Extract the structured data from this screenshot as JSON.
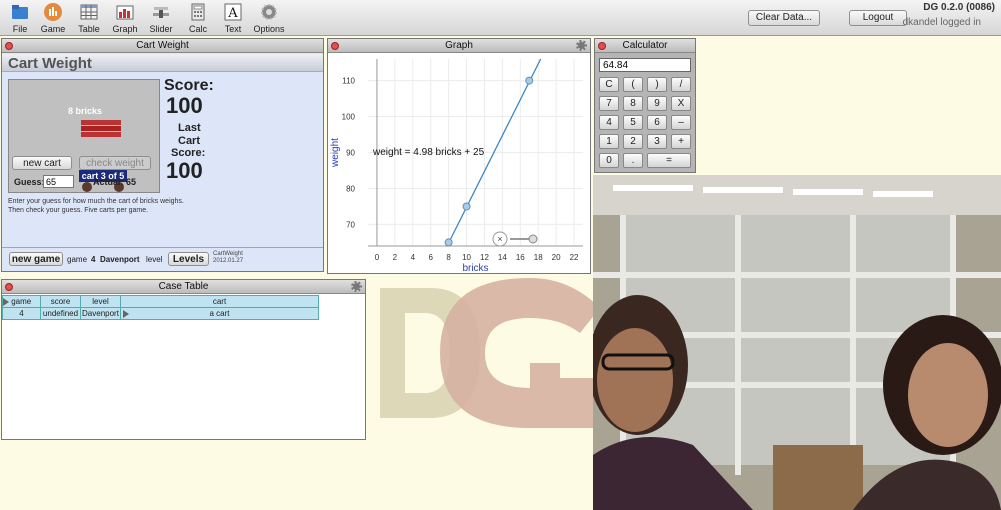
{
  "toolbar": {
    "items": [
      {
        "label": "File",
        "icon": "folder-icon"
      },
      {
        "label": "Game",
        "icon": "game-icon"
      },
      {
        "label": "Table",
        "icon": "table-icon"
      },
      {
        "label": "Graph",
        "icon": "graph-icon"
      },
      {
        "label": "Slider",
        "icon": "slider-icon"
      },
      {
        "label": "Calc",
        "icon": "calculator-icon"
      },
      {
        "label": "Text",
        "icon": "text-icon"
      },
      {
        "label": "Options",
        "icon": "gear-icon"
      }
    ],
    "clear_data": "Clear Data...",
    "logout": "Logout",
    "version": "DG 0.2.0 (0086)",
    "user": "dkandel logged in"
  },
  "cart_panel": {
    "title": "Cart Weight",
    "heading": "Cart Weight",
    "bricks_label": "8 bricks",
    "cart_label": "cart 3 of 5",
    "new_cart": "new cart",
    "check_weight": "check weight",
    "guess_label": "Guess:",
    "guess_value": "65",
    "actual_label": "Actual:",
    "actual_value": "65",
    "score_label": "Score:",
    "score_value": "100",
    "last_label_1": "Last",
    "last_label_2": "Cart",
    "last_label_3": "Score:",
    "last_value": "100",
    "instructions_1": "Enter your guess for how much the cart of bricks weighs.",
    "instructions_2": "Then check your guess. Five carts per game.",
    "new_game": "new game",
    "game_label": "game",
    "game_number": "4",
    "level_name": "Davenport",
    "level_label": "level",
    "levels_button": "Levels",
    "app_name": "CartWeight",
    "app_date": "2012.01.27"
  },
  "graph_panel": {
    "title": "Graph",
    "equation": "weight = 4.98 bricks + 25"
  },
  "chart_data": {
    "type": "scatter",
    "title": "",
    "xlabel": "bricks",
    "ylabel": "weight",
    "xlim": [
      -1,
      23
    ],
    "ylim": [
      64,
      116
    ],
    "xticks": [
      "0",
      "2",
      "4",
      "6",
      "8",
      "10",
      "12",
      "14",
      "16",
      "18",
      "20",
      "22"
    ],
    "yticks": [
      "70",
      "80",
      "90",
      "100",
      "110"
    ],
    "points": [
      {
        "x": 8,
        "y": 65
      },
      {
        "x": 10,
        "y": 75
      },
      {
        "x": 17,
        "y": 110
      }
    ],
    "line": {
      "slope": 4.98,
      "intercept": 25
    },
    "grid": true
  },
  "calculator": {
    "title": "Calculator",
    "display": "64.84",
    "keys": [
      [
        "C",
        "(",
        ")",
        "/"
      ],
      [
        "7",
        "8",
        "9",
        "X"
      ],
      [
        "4",
        "5",
        "6",
        "–"
      ],
      [
        "1",
        "2",
        "3",
        "+"
      ],
      [
        "0",
        ".",
        "="
      ]
    ]
  },
  "case_table": {
    "title": "Case Table",
    "columns": [
      "game",
      "score",
      "level",
      "cart"
    ],
    "rows": [
      [
        "4",
        "undefined",
        "Davenport",
        "a cart"
      ]
    ]
  },
  "colors": {
    "panel_bg": "#dde6f8",
    "accent_line": "#3b86c6",
    "point_fill": "#a9cbe6",
    "page_bg": "#fdfbe3"
  }
}
